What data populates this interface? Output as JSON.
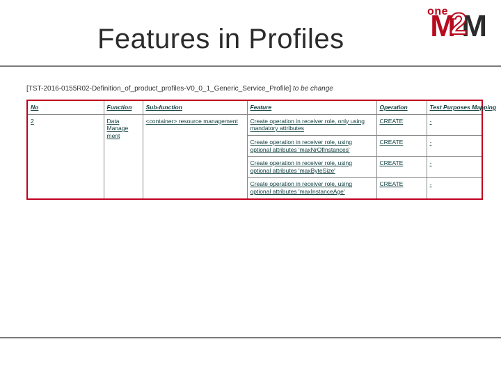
{
  "header": {
    "title": "Features in Profiles",
    "logo": {
      "one": "one",
      "m1": "M",
      "two": "2",
      "m2": "M"
    }
  },
  "subref": {
    "ref": "[TST-2016-0155R02-Definition_of_product_profiles-V0_0_1_Generic_Service_Profile]",
    "note": "to be change"
  },
  "table": {
    "headers": {
      "no": "No",
      "function": "Function",
      "sub_function": "Sub-function",
      "feature": "Feature",
      "operation": "Operation",
      "test_purposes_mapping": "Test Purposes Mapping"
    },
    "no": "2",
    "function": "Data Manage ment",
    "sub_function": "<container> resource management",
    "rows": [
      {
        "feature": "Create operation in receiver role, only using mandatory attributes",
        "operation": "CREATE",
        "tpm": "-"
      },
      {
        "feature": "Create operation in receiver role, using optional attributes 'maxNrOfInstances'",
        "operation": "CREATE",
        "tpm": "-"
      },
      {
        "feature": "Create operation in receiver role, using optional attributes 'maxByteSize'",
        "operation": "CREATE",
        "tpm": "-"
      },
      {
        "feature": "Create operation in receiver role, using optional attributes 'maxInstanceAge'",
        "operation": "CREATE",
        "tpm": "-"
      }
    ]
  }
}
